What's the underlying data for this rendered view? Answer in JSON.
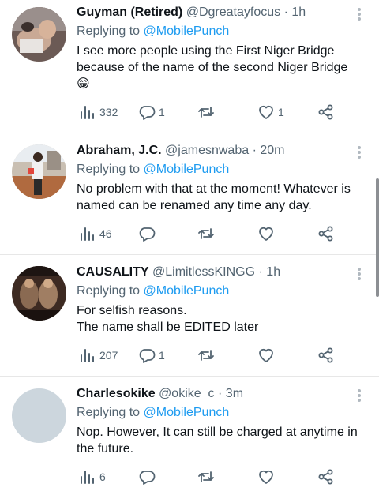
{
  "tweets": [
    {
      "name": "Guyman (Retired)",
      "handle": "@Dgreatayfocus",
      "separator": "·",
      "time": "1h",
      "replying_prefix": "Replying to",
      "replying_to": "@MobilePunch",
      "text_lines": [
        "I see more people using the First Niger Bridge",
        "because of the name of the second Niger Bridge",
        "😁"
      ],
      "views": "332",
      "replies": "1",
      "retweets": "",
      "likes": "1"
    },
    {
      "name": "Abraham, J.C.",
      "handle": "@jamesnwaba",
      "separator": "·",
      "time": "20m",
      "replying_prefix": "Replying to",
      "replying_to": "@MobilePunch",
      "text_lines": [
        "No problem with that at the moment! Whatever is",
        "named can be renamed any time any day."
      ],
      "views": "46",
      "replies": "",
      "retweets": "",
      "likes": ""
    },
    {
      "name": "CAUSALITY",
      "handle": "@LimitlessKINGG",
      "separator": "·",
      "time": "1h",
      "replying_prefix": "Replying to",
      "replying_to": "@MobilePunch",
      "text_lines": [
        "For selfish reasons.",
        "The name shall be EDITED later"
      ],
      "views": "207",
      "replies": "1",
      "retweets": "",
      "likes": ""
    },
    {
      "name": "Charlesokike",
      "handle": "@okike_c",
      "separator": "·",
      "time": "3m",
      "replying_prefix": "Replying to",
      "replying_to": "@MobilePunch",
      "text_lines": [
        "Nop. However, It can still be charged at anytime in",
        "the future."
      ],
      "views": "6",
      "replies": "",
      "retweets": "",
      "likes": ""
    }
  ],
  "icons": {
    "views": "bar-chart-icon",
    "reply": "speech-bubble-icon",
    "retweet": "retweet-arrows-icon",
    "like": "heart-icon",
    "share": "share-nodes-icon",
    "more": "more-vertical-icon"
  },
  "colors": {
    "text": "#0f1419",
    "muted": "#536471",
    "mention": "#1d9bf0",
    "divider": "#e7e7e7"
  }
}
